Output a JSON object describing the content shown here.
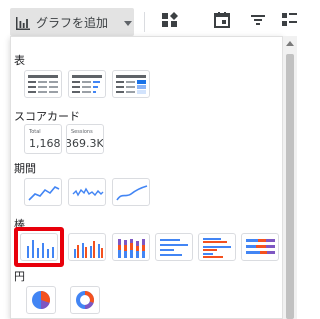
{
  "toolbar": {
    "add_chart_label": "グラフを追加",
    "add_chart_icon": "bar-chart-icon",
    "icons": [
      "add-control-icon",
      "calendar-icon",
      "filter-icon",
      "data-icon"
    ]
  },
  "sections": {
    "table": {
      "label": "表",
      "items": [
        "table",
        "table-with-bars",
        "table-with-heatmap"
      ]
    },
    "scorecard": {
      "label": "スコアカード",
      "items": [
        {
          "label": "Total",
          "value": "1,168"
        },
        {
          "label": "Sessions",
          "value": "369.3K"
        }
      ]
    },
    "timeseries": {
      "label": "期間",
      "items": [
        "time-series",
        "sparkline",
        "smoothed-time-series"
      ]
    },
    "bar": {
      "label": "棒",
      "items": [
        "column-chart",
        "grouped-column-chart",
        "stacked-column-chart",
        "bar-chart",
        "grouped-bar-chart",
        "stacked-bar-chart"
      ]
    },
    "pie": {
      "label": "円",
      "items": [
        "pie-chart",
        "donut-chart"
      ]
    }
  },
  "colors": {
    "accent_blue": "#4285f4",
    "accent_orange": "#f4511e",
    "accent_purple": "#7e57c2",
    "highlight_red": "#e8000b"
  }
}
